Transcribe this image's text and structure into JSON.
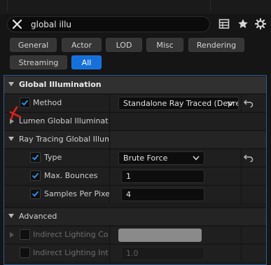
{
  "search": {
    "value": "global illu",
    "placeholder": ""
  },
  "toolbar": {
    "table_icon": "table-view-icon",
    "star_icon": "favorite-star-icon",
    "settings_icon": "settings-gear-icon"
  },
  "filters": [
    {
      "label": "General",
      "active": false
    },
    {
      "label": "Actor",
      "active": false
    },
    {
      "label": "LOD",
      "active": false
    },
    {
      "label": "Misc",
      "active": false
    },
    {
      "label": "Rendering",
      "active": false
    },
    {
      "label": "Streaming",
      "active": false
    },
    {
      "label": "All",
      "active": true
    }
  ],
  "sections": {
    "gi": {
      "title": "Global Illumination",
      "method_label": "Method",
      "method_value": "Standalone Ray Traced (Deprecated)",
      "lumen_label": "Lumen Global Illumination"
    },
    "rtgi": {
      "title": "Ray Tracing Global Illumination",
      "type_label": "Type",
      "type_value": "Brute Force",
      "bounces_label": "Max. Bounces",
      "bounces_value": "1",
      "samples_label": "Samples Per Pixel",
      "samples_value": "4"
    },
    "advanced": {
      "title": "Advanced",
      "indirect_color_label": "Indirect Lighting Color",
      "indirect_intensity_label": "Indirect Lighting Intensity",
      "indirect_intensity_value": "1.0"
    }
  },
  "colors": {
    "accent": "#1571d9",
    "panel_border": "#2d5f95",
    "check": "#2f8ff0",
    "annotation": "#e02020"
  }
}
